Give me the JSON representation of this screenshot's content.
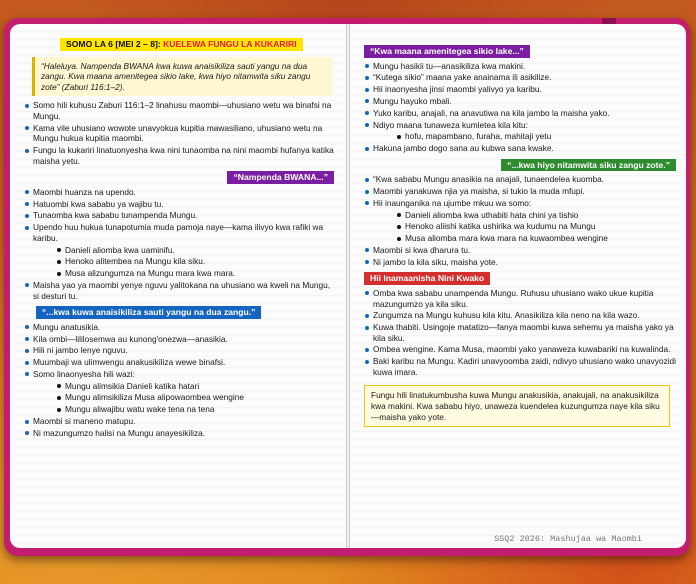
{
  "left": {
    "header_main": "SOMO LA 6 [MEI 2 – 8]:",
    "header_sub": "KUELEWA FUNGU LA KUKARIRI",
    "quote": "“Haleluya. Nampenda BWANA kwa kuwa anaisikiliza sauti yangu na dua zangu. Kwa maana amenitegea sikio lake, kwa hiyo nitamwita siku zangu zote” (Zaburi 116:1–2).",
    "intro": [
      "Somo hili kuhusu Zaburi 116:1–2 linahusu maombi—uhusiano wetu wa binafsi na Mungu.",
      "Kama vile uhusiano wowote unavyokua kupitia mawasiliano, uhusiano wetu na Mungu hukua kupitia maombi.",
      "Fungu la kukariri linatuonyesha kwa nini tunaomba na nini maombi hufanya katika maisha yetu."
    ],
    "section1": "“Nampenda BWANA...”",
    "s1_items": [
      "Maombi huanza na upendo.",
      "Hatuombi kwa sababu ya wajibu tu.",
      "Tunaomba kwa sababu tunampenda Mungu.",
      "Upendo huu hukua tunapotumia muda pamoja naye—kama ilivyo kwa rafiki wa karibu."
    ],
    "s1_sub": [
      "Danieli aliomba kwa uaminifu.",
      "Henoko alitembea na Mungu kila siku.",
      "Musa alizungumza na Mungu mara kwa mara."
    ],
    "s1_end": "Maisha yao ya maombi yenye nguvu yalitokana na uhusiano wa kweli na Mungu, si desturi tu.",
    "section2": "“...kwa kuwa anaisikiliza sauti yangu na dua zangu.”",
    "s2_items": [
      "Mungu anatusikia.",
      "Kila ombi—lililosemwa au kunong'onezwa—anasikia.",
      "Hili ni jambo lenye nguvu.",
      "Muumbaji wa ulimwengu anakusikiliza wewe binafsi.",
      "Somo linaonyesha hili wazi:"
    ],
    "s2_sub": [
      "Mungu alimsikia Danieli katika hatari",
      "Mungu alimsikiliza Musa alipowaombea wengine",
      "Mungu aliwajibu watu wake tena na tena"
    ],
    "s2_end": [
      "Maombi si maneno matupu.",
      "Ni mazungumzo halisi na Mungu anayesikiliza."
    ]
  },
  "right": {
    "section3": "“Kwa maana amenitegea sikio lake...”",
    "s3_items": [
      "Mungu hasikii tu—anasikiliza kwa makini.",
      "“Kutega sikio” maana yake anainama ili asikilize.",
      "Hii inaonyesha jinsi maombi yalivyo ya karibu.",
      "Mungu hayuko mbali.",
      "Yuko karibu, anajali, na anavutiwa na kila jambo la maisha yako.",
      "Ndiyo maana tunaweza kumletea kila kitu:"
    ],
    "s3_sub": "hofu, mapambano, furaha, mahitaji yetu",
    "s3_end": "Hakuna jambo dogo sana au kubwa sana kwake.",
    "section4": "“...kwa hiyo nitamwita siku zangu zote.”",
    "s4_items": [
      "“Kwa sababu Mungu anasikia na anajali, tunaendelea kuomba.",
      "Maombi yanakuwa njia ya maisha, si tukio la muda mfupi.",
      "Hii inaunganika na ujumbe mkuu wa somo:"
    ],
    "s4_sub": [
      "Danieli aliomba kwa uthabiti hata chini ya tishio",
      "Henoko aliishi katika ushirika wa kudumu na Mungu",
      "Musa aliomba mara kwa mara na kuwaombea wengine"
    ],
    "s4_end": [
      "Maombi si kwa dharura tu.",
      "Ni jambo la kila siku, maisha yote."
    ],
    "section5": "Hii Inamaanisha Nini Kwako",
    "s5_items": [
      "Omba kwa sababu unampenda Mungu. Ruhusu uhusiano wako ukue kupitia mazungumzo ya kila siku.",
      "Zungumza na Mungu kuhusu kila kitu. Anasikiliza kila neno na kila wazo.",
      "Kuwa thabiti. Usingoje matatizo—fanya maombi kuwa sehemu ya maisha yako ya kila siku.",
      "Ombea wengine. Kama Musa, maombi yako yanaweza kuwabariki na kuwalinda.",
      "Baki karibu na Mungu. Kadiri unavyoomba zaidi, ndivyo uhusiano wako unavyozidi kuwa imara."
    ],
    "closing": "Fungu hili linatukumbusha kuwa Mungu anakusikia, anakujali, na anakusikiliza kwa makini. Kwa sababu hiyo, unaweza kuendelea kuzungumza naye kila siku—maisha yako yote.",
    "footer": "SSQ2 2026: Mashujaa wa Maombi"
  }
}
